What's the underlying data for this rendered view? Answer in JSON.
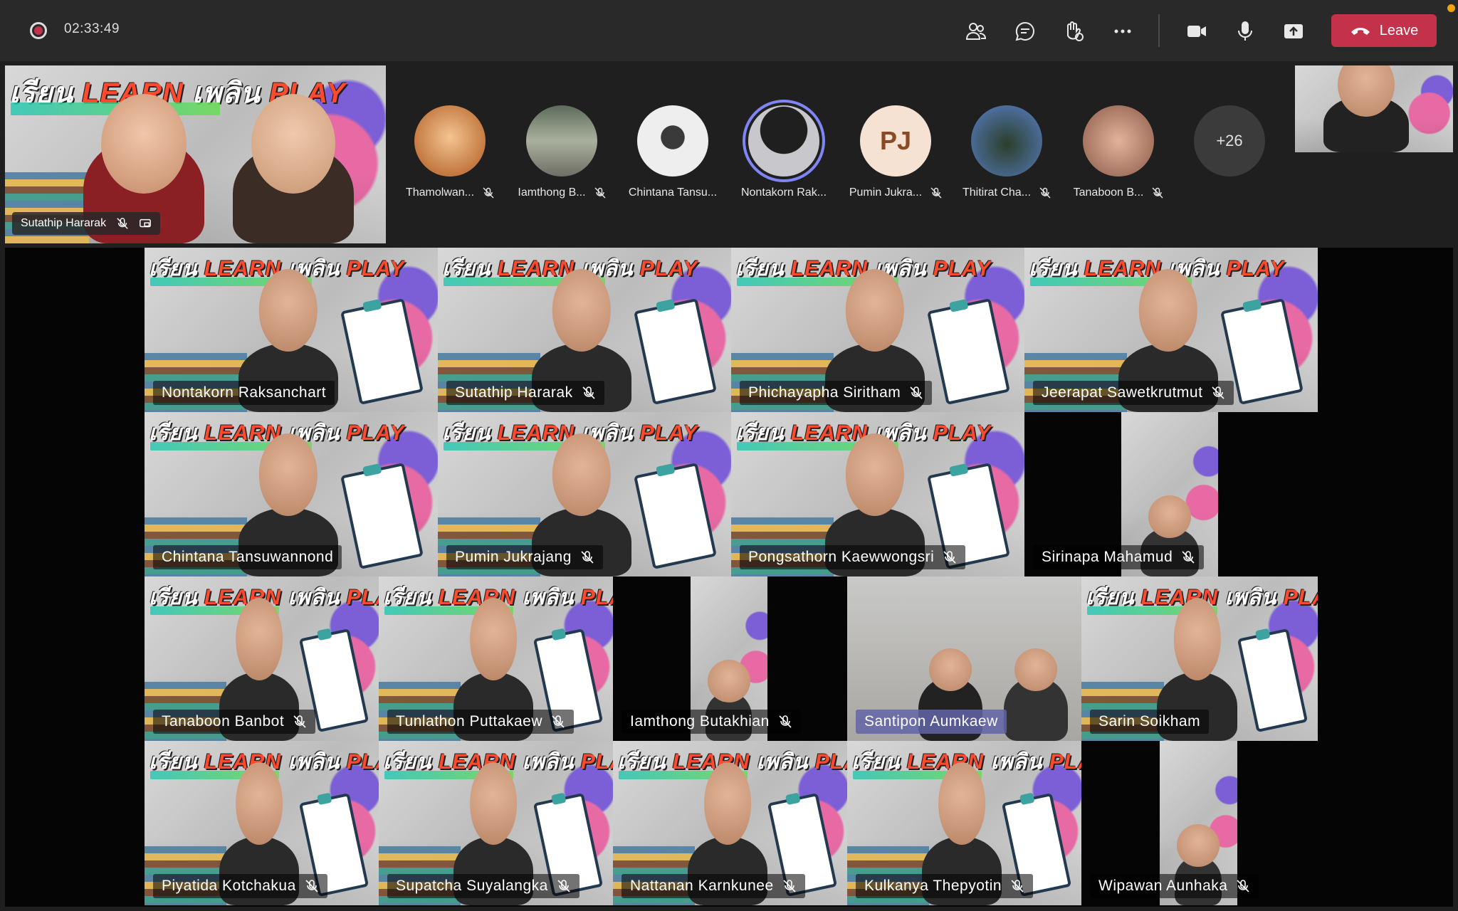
{
  "toolbar": {
    "timer": "02:33:49",
    "leave_label": "Leave",
    "icons": [
      "people-icon",
      "chat-icon",
      "raise-hand-icon",
      "more-options-icon",
      "camera-icon",
      "microphone-icon",
      "share-screen-icon",
      "phone-hangup-icon"
    ]
  },
  "featured": {
    "name": "Sutathip Hararak",
    "poster_title_1": "เรียน",
    "poster_title_2": "LEARN",
    "poster_title_3": "เพลิน",
    "poster_title_4": "PLAY"
  },
  "avatars": [
    {
      "name": "Thamolwan...",
      "muted": true
    },
    {
      "name": "Iamthong B...",
      "muted": true
    },
    {
      "name": "Chintana Tansu...",
      "muted": false
    },
    {
      "name": "Nontakorn Rak...",
      "muted": false
    },
    {
      "name": "Pumin Jukra...",
      "muted": true,
      "initials": "PJ"
    },
    {
      "name": "Thitirat Cha...",
      "muted": true
    },
    {
      "name": "Tanaboon B...",
      "muted": true
    }
  ],
  "more_count": "+26",
  "tiles": [
    {
      "name": "Nontakorn Raksanchart"
    },
    {
      "name": "Sutathip Hararak"
    },
    {
      "name": "Phichayapha Siritham"
    },
    {
      "name": "Jeerapat Sawetkrutmut"
    },
    {
      "name": "Chintana Tansuwannond"
    },
    {
      "name": "Pumin Jukrajang"
    },
    {
      "name": "Pongsathorn Kaewwongsri"
    },
    {
      "name": "Sirinapa Mahamud"
    },
    {
      "name": "Tanaboon Banbot"
    },
    {
      "name": "Tunlathon Puttakaew"
    },
    {
      "name": "Iamthong Butakhian"
    },
    {
      "name": "Santipon Aumkaew"
    },
    {
      "name": "Sarin Soikham"
    },
    {
      "name": "Piyatida Kotchakua"
    },
    {
      "name": "Supatcha Suyalangka"
    },
    {
      "name": "Nattanan Karnkunee"
    },
    {
      "name": "Kulkanya Thepyotin"
    },
    {
      "name": "Wipawan Aunhaka"
    }
  ],
  "colors": {
    "leave": "#c4314b",
    "active_ring": "#7f85f5",
    "highlight_label": "#6264a7"
  }
}
